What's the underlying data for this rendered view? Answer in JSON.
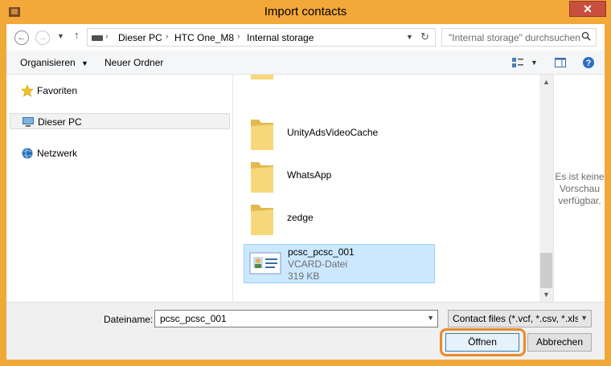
{
  "window": {
    "title": "Import contacts",
    "close_label": "✕"
  },
  "navbar": {
    "breadcrumbs": [
      "Dieser PC",
      "HTC One_M8",
      "Internal storage"
    ],
    "search_placeholder": "\"Internal storage\" durchsuchen"
  },
  "toolbar": {
    "organize_label": "Organisieren",
    "new_folder_label": "Neuer Ordner"
  },
  "sidebar": {
    "items": [
      {
        "label": "Favoriten",
        "icon": "star-icon"
      },
      {
        "label": "Dieser PC",
        "icon": "computer-icon"
      },
      {
        "label": "Netzwerk",
        "icon": "network-icon"
      }
    ]
  },
  "files": [
    {
      "name": "UnityAdsVideoCache",
      "type": "folder"
    },
    {
      "name": "WhatsApp",
      "type": "folder"
    },
    {
      "name": "zedge",
      "type": "folder"
    },
    {
      "name": "pcsc_pcsc_001",
      "type": "VCARD-Datei",
      "size": "319 KB"
    }
  ],
  "preview": {
    "line1": "Es ist keine",
    "line2": "Vorschau",
    "line3": "verfügbar."
  },
  "footer": {
    "filename_label": "Dateiname:",
    "filename_value": "pcsc_pcsc_001",
    "filter_value": "Contact files (*.vcf, *.csv, *.xls, *",
    "open_label": "Öffnen",
    "cancel_label": "Abbrechen"
  },
  "colors": {
    "title_bar": "#f2a93a",
    "selection": "#cce8ff",
    "highlight_ring": "#e88a2c",
    "close_button": "#c74f3f"
  }
}
